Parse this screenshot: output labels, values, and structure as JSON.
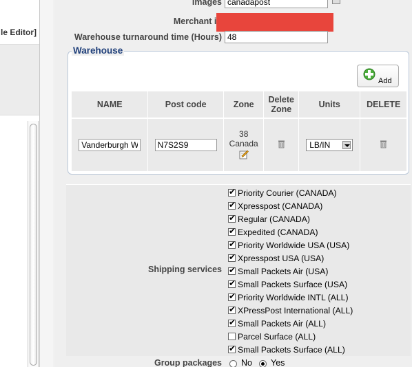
{
  "left_panel": {
    "header": "le Editor]"
  },
  "form": {
    "images_label": "Images",
    "images_value": "canadapost",
    "merchant_label": "Merchant id",
    "turnaround_label": "Warehouse turnaround time (Hours)",
    "turnaround_value": "48"
  },
  "warehouse": {
    "legend": "Warehouse",
    "add_label": "Add",
    "columns": [
      "NAME",
      "Post code",
      "Zone",
      "Delete Zone",
      "Units",
      "DELETE"
    ],
    "row": {
      "name": "Vanderburgh W",
      "postcode": "N7S2S9",
      "zone_number": "38",
      "zone_name": "Canada",
      "units": "LB/IN"
    }
  },
  "shipping": {
    "label": "Shipping services",
    "services": [
      {
        "label": "Priority Courier (CANADA)",
        "checked": true
      },
      {
        "label": "Xpresspost (CANADA)",
        "checked": true
      },
      {
        "label": "Regular (CANADA)",
        "checked": true
      },
      {
        "label": "Expedited (CANADA)",
        "checked": true
      },
      {
        "label": "Priority Worldwide USA (USA)",
        "checked": true
      },
      {
        "label": "Xpresspost USA (USA)",
        "checked": true
      },
      {
        "label": "Small Packets Air (USA)",
        "checked": true
      },
      {
        "label": "Small Packets Surface (USA)",
        "checked": true
      },
      {
        "label": "Priority Worldwide INTL (ALL)",
        "checked": true
      },
      {
        "label": "XPressPost International (ALL)",
        "checked": true
      },
      {
        "label": "Small Packets Air (ALL)",
        "checked": true
      },
      {
        "label": "Parcel Surface (ALL)",
        "checked": false
      },
      {
        "label": "Small Packets Surface (ALL)",
        "checked": true
      }
    ]
  },
  "group_packages": {
    "label": "Group packages",
    "options": [
      {
        "label": "No",
        "selected": false
      },
      {
        "label": "Yes",
        "selected": true
      }
    ]
  },
  "colors": {
    "legend": "#1f3f7a",
    "redaction": "#e8453c",
    "panel_bg": "#efefef"
  },
  "icons": [
    "plus-icon",
    "edit-icon",
    "trash-icon",
    "chevron-down-icon",
    "checkbox-icon",
    "radio-icon"
  ]
}
